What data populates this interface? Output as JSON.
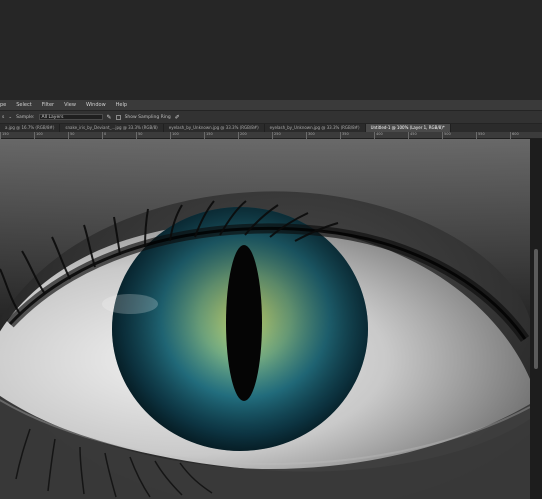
{
  "menubar": {
    "items": [
      "pe",
      "Select",
      "Filter",
      "View",
      "Window",
      "Help"
    ]
  },
  "options_bar": {
    "first": "s",
    "sample_label": "Sample:",
    "sample_value": "All Layers",
    "check_label": "Show Sampling Ring"
  },
  "tabs": [
    {
      "label": "a.jpg @ 16.7% (RGB/8#)",
      "active": false
    },
    {
      "label": "snake_iris_by_Deviant_...jpg @ 33.3% (RGB/8)",
      "active": false
    },
    {
      "label": "eyelash_by_Unknown.jpg @ 33.3% (RGB/8#)",
      "active": false
    },
    {
      "label": "eyelash_by_Unknown.jpg @ 33.3% (RGB/8#)",
      "active": false
    },
    {
      "label": "Untitled-1 @ 100% (Layer 1, RGB/8)*",
      "active": true
    }
  ],
  "ruler": {
    "labels": [
      "150",
      "100",
      "50",
      "0",
      "50",
      "100",
      "150",
      "200",
      "250",
      "300",
      "350",
      "400",
      "450",
      "500",
      "550",
      "600"
    ]
  },
  "colors": {
    "iris_outer": "#0a2f3d",
    "iris_mid": "#2b8aa0",
    "iris_inner": "#b7c84a",
    "pupil": "#050505",
    "sclera": "#d7d7d7"
  }
}
